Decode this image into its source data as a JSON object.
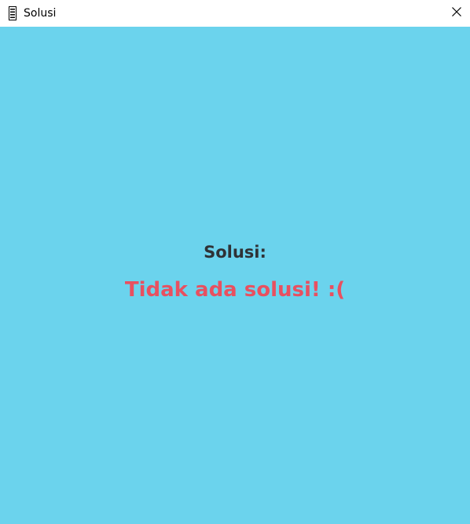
{
  "window": {
    "title": "Solusi",
    "background_color": "#6bd3ed",
    "app_icon": "window-app-icon",
    "close_icon": "close-icon"
  },
  "main": {
    "heading": "Solusi:",
    "heading_color": "#2f3236",
    "result": "Tidak ada solusi! :(",
    "result_color": "#e85060"
  }
}
